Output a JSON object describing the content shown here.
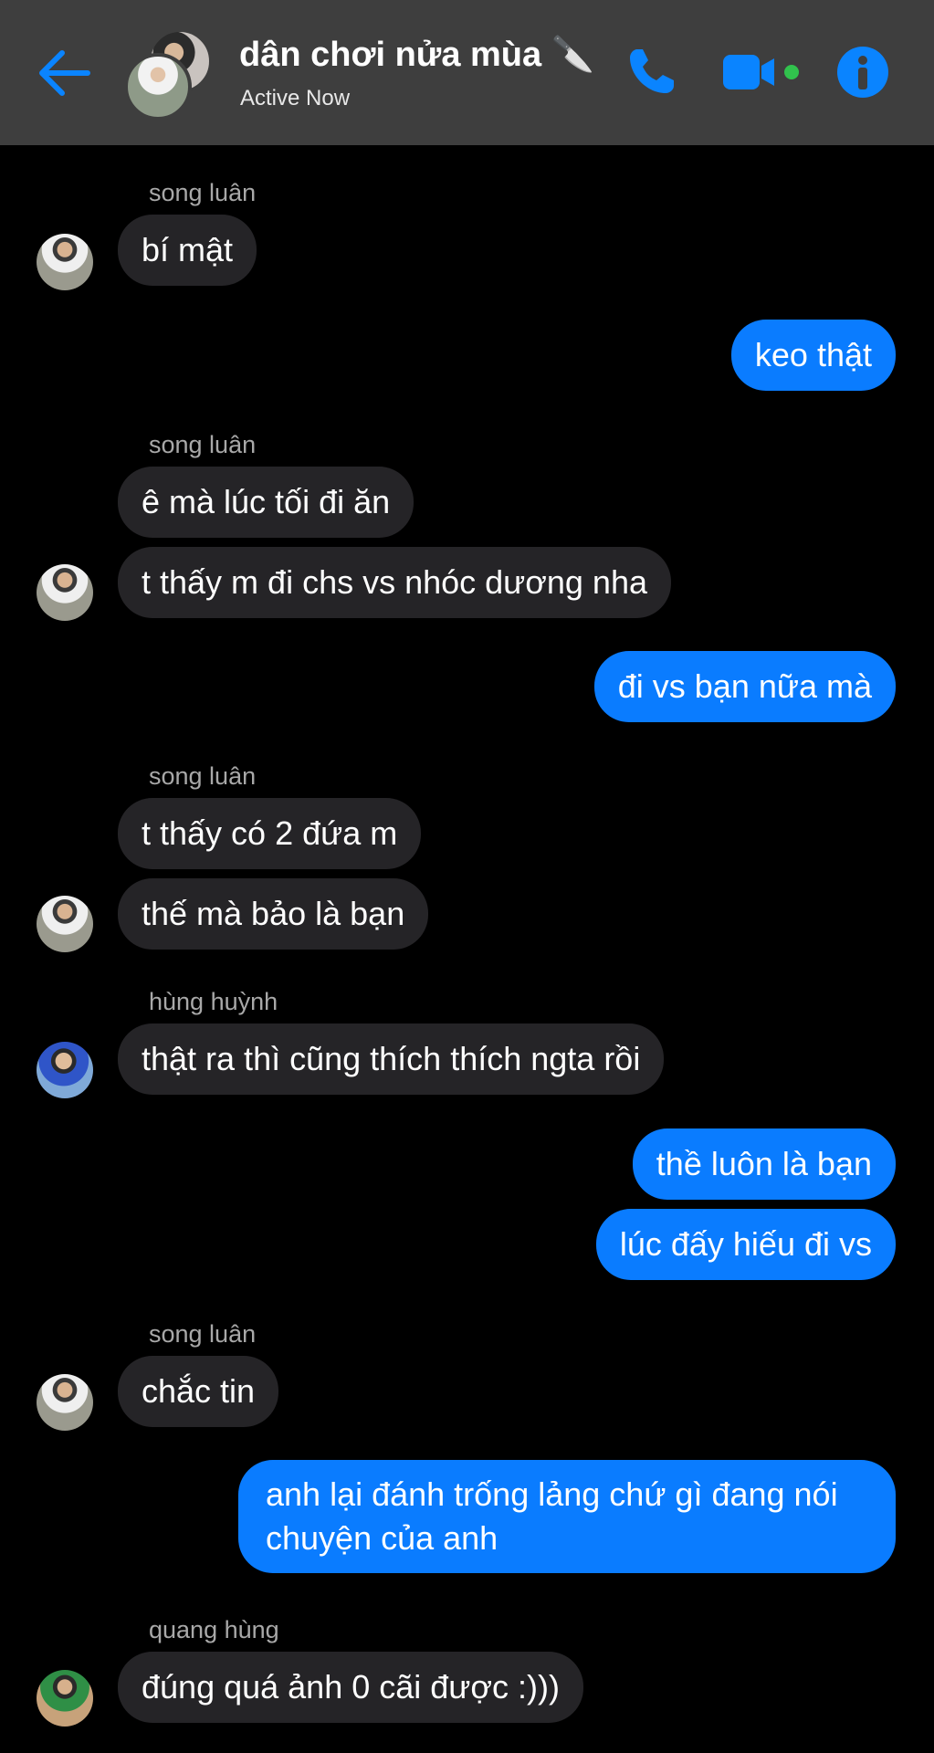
{
  "header": {
    "title": "dân chơi nửa mùa 🔪",
    "status": "Active Now",
    "accent_color": "#0a84ff",
    "video_dot_color": "#31c24d",
    "icons": {
      "back": "back-arrow-icon",
      "call": "phone-icon",
      "video": "video-camera-icon",
      "info": "info-icon"
    }
  },
  "messages": [
    {
      "sender": "song luân",
      "texts": [
        "bí mật"
      ]
    },
    {
      "outgoing": true,
      "texts": [
        "keo thật"
      ]
    },
    {
      "sender": "song luân",
      "texts": [
        "ê mà lúc tối đi ăn",
        "t thấy m đi chs vs nhóc dương nha"
      ]
    },
    {
      "outgoing": true,
      "texts": [
        "đi vs bạn nữa mà"
      ]
    },
    {
      "sender": "song luân",
      "texts": [
        "t thấy có 2 đứa m",
        "thế mà bảo là bạn"
      ]
    },
    {
      "sender": "hùng huỳnh",
      "texts": [
        "thật ra thì cũng thích thích ngta rồi"
      ]
    },
    {
      "outgoing": true,
      "texts": [
        "thề luôn là bạn",
        "lúc đấy hiếu đi vs"
      ]
    },
    {
      "sender": "song luân",
      "texts": [
        "chắc tin"
      ]
    },
    {
      "outgoing": true,
      "texts": [
        "anh lại đánh trống lảng chứ gì đang nói chuyện của anh"
      ]
    },
    {
      "sender": "quang hùng",
      "texts": [
        "đúng quá ảnh 0 cãi được :)))"
      ]
    }
  ],
  "colors": {
    "incoming_bubble": "#252427",
    "outgoing_bubble": "#0a7cff",
    "background": "#000000",
    "header": "#3e3e3e"
  }
}
